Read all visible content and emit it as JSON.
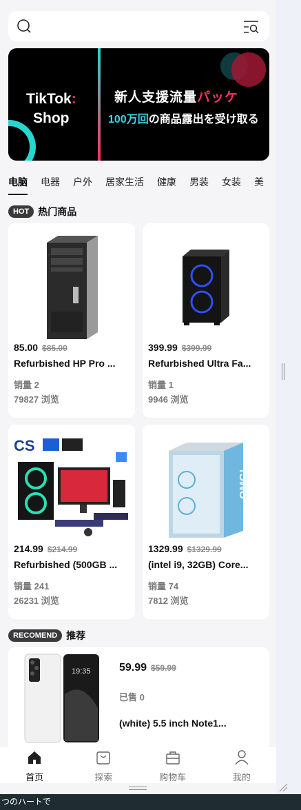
{
  "search": {
    "placeholder": ""
  },
  "banner": {
    "logo_line1": "TikTok",
    "logo_line2": "Shop",
    "headline_main": "新人支援流量",
    "headline_accent": "パッケ",
    "sub_accent": "100万回",
    "sub_rest": "の商品露出を受け取る"
  },
  "categories": [
    "电脑",
    "电器",
    "户外",
    "居家生活",
    "健康",
    "男装",
    "女装",
    "美"
  ],
  "hot": {
    "badge": "HOT",
    "title": "热门商品"
  },
  "products": [
    {
      "price": "85.00",
      "old_price": "$85.00",
      "title": "Refurbished HP Pro ...",
      "sales": "销量  2",
      "views": "79827 浏览"
    },
    {
      "price": "399.99",
      "old_price": "$399.99",
      "title": "Refurbished Ultra Fa...",
      "sales": "销量  1",
      "views": "9946 浏览"
    },
    {
      "price": "214.99",
      "old_price": "$214.99",
      "title": "Refurbished (500GB ...",
      "sales": "销量  241",
      "views": "26231 浏览"
    },
    {
      "price": "1329.99",
      "old_price": "$1329.99",
      "title": "(intel i9, 32GB) Core...",
      "sales": "销量  74",
      "views": "7812 浏览"
    }
  ],
  "recommend": {
    "badge": "RECOMEND",
    "title": "推荐",
    "item": {
      "price": "59.99",
      "old_price": "$59.99",
      "sold": "已售  0",
      "title": "(white) 5.5 inch Note1..."
    }
  },
  "tabbar": [
    "首页",
    "探索",
    "购物车",
    "我的"
  ],
  "bottom_text": "つのハートで"
}
